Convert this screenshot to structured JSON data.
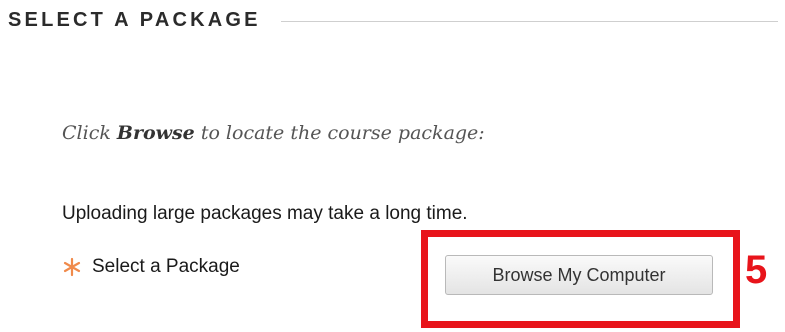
{
  "section": {
    "title": "SELECT A PACKAGE"
  },
  "instructions": {
    "before": "Click ",
    "emphasis": "Browse",
    "after": " to locate the course package:"
  },
  "note": "Uploading large packages may take a long time.",
  "field": {
    "label": "Select a Package",
    "required_icon": "asterisk-icon"
  },
  "browse_button": {
    "label": "Browse My Computer"
  },
  "annotation": {
    "step_number": "5"
  },
  "colors": {
    "annotation_red": "#e8141b",
    "required_orange": "#f08a4b"
  }
}
